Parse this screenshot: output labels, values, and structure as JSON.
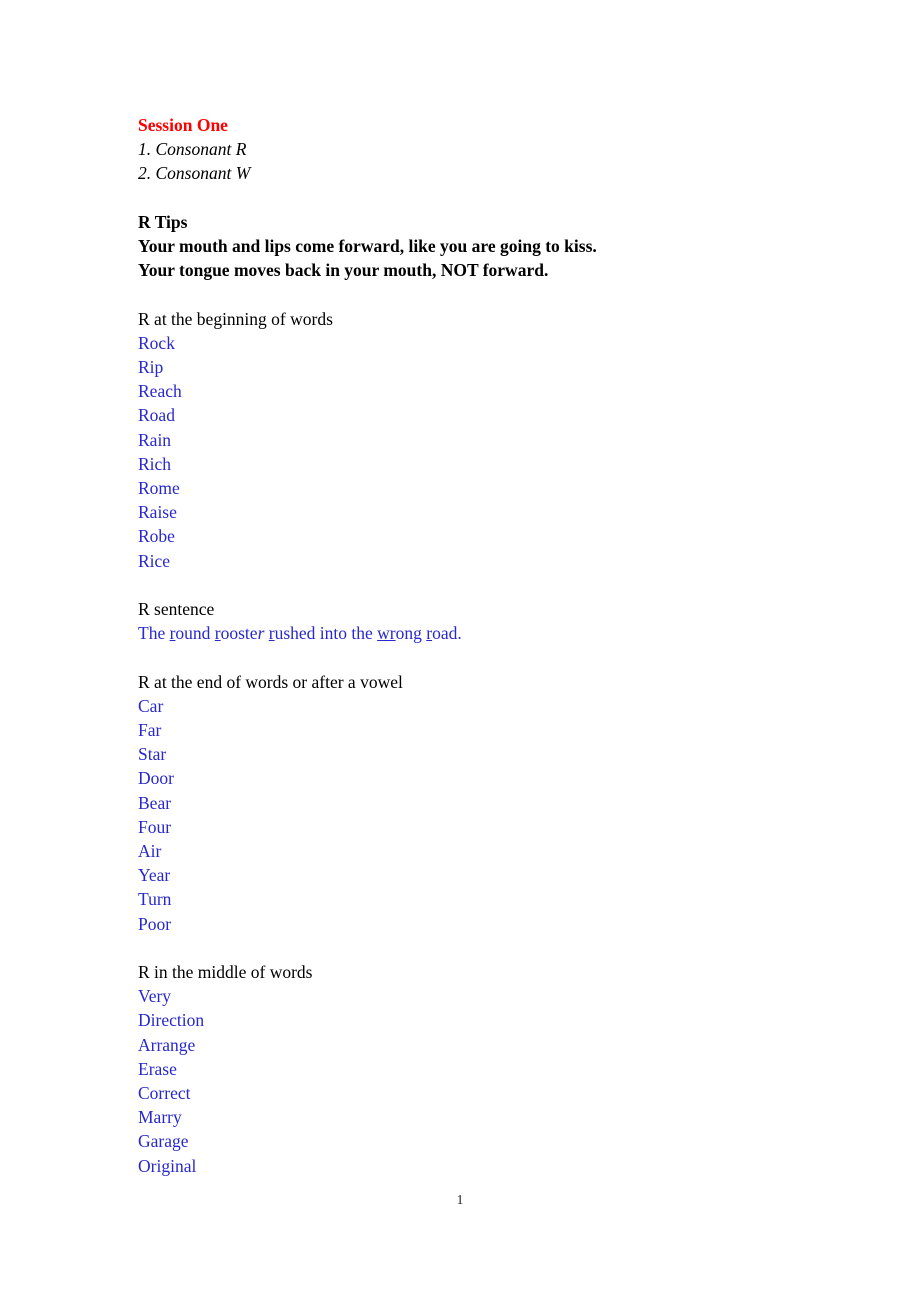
{
  "document": {
    "title": "Session One",
    "title_color": "#ff0000",
    "word_color": "#2828cc",
    "body_color": "#000000",
    "contents": [
      {
        "number": "1.",
        "text": "1. Consonant R"
      },
      {
        "number": "2.",
        "text": "2. Consonant W"
      }
    ],
    "tips": {
      "heading": "R Tips",
      "lines": [
        "Your mouth and lips come forward, like you are going to kiss.",
        "Your tongue moves back in your mouth, NOT forward."
      ]
    },
    "sections": [
      {
        "label": "R at the beginning of words",
        "words": [
          "Rock",
          "Rip",
          "Reach",
          "Road",
          "Rain",
          "Rich",
          "Rome",
          "Raise",
          "Robe",
          "Rice"
        ]
      },
      {
        "label": "R sentence",
        "sentence_plain": "The round rooster rushed into the wrong road.",
        "sentence_parts": [
          {
            "text": "The ",
            "underline": false,
            "italic": false
          },
          {
            "text": "r",
            "underline": true,
            "italic": false
          },
          {
            "text": "ound ",
            "underline": false,
            "italic": false
          },
          {
            "text": "r",
            "underline": true,
            "italic": false
          },
          {
            "text": "ooste",
            "underline": false,
            "italic": false
          },
          {
            "text": "r",
            "underline": false,
            "italic": true
          },
          {
            "text": " ",
            "underline": false,
            "italic": false
          },
          {
            "text": "r",
            "underline": true,
            "italic": false
          },
          {
            "text": "ushed into the ",
            "underline": false,
            "italic": false
          },
          {
            "text": "wr",
            "underline": true,
            "italic": false
          },
          {
            "text": "ong ",
            "underline": false,
            "italic": false
          },
          {
            "text": "r",
            "underline": true,
            "italic": false
          },
          {
            "text": "oad.",
            "underline": false,
            "italic": false
          }
        ]
      },
      {
        "label": "R at the end of words or after a vowel",
        "words": [
          "Car",
          "Far",
          "Star",
          "Door",
          "Bear",
          "Four",
          "Air",
          "Year",
          "Turn",
          "Poor"
        ]
      },
      {
        "label": "R in the middle of words",
        "words": [
          "Very",
          "Direction",
          "Arrange",
          "Erase",
          "Correct",
          "Marry",
          "Garage",
          "Original"
        ]
      }
    ],
    "page_number": "1"
  }
}
